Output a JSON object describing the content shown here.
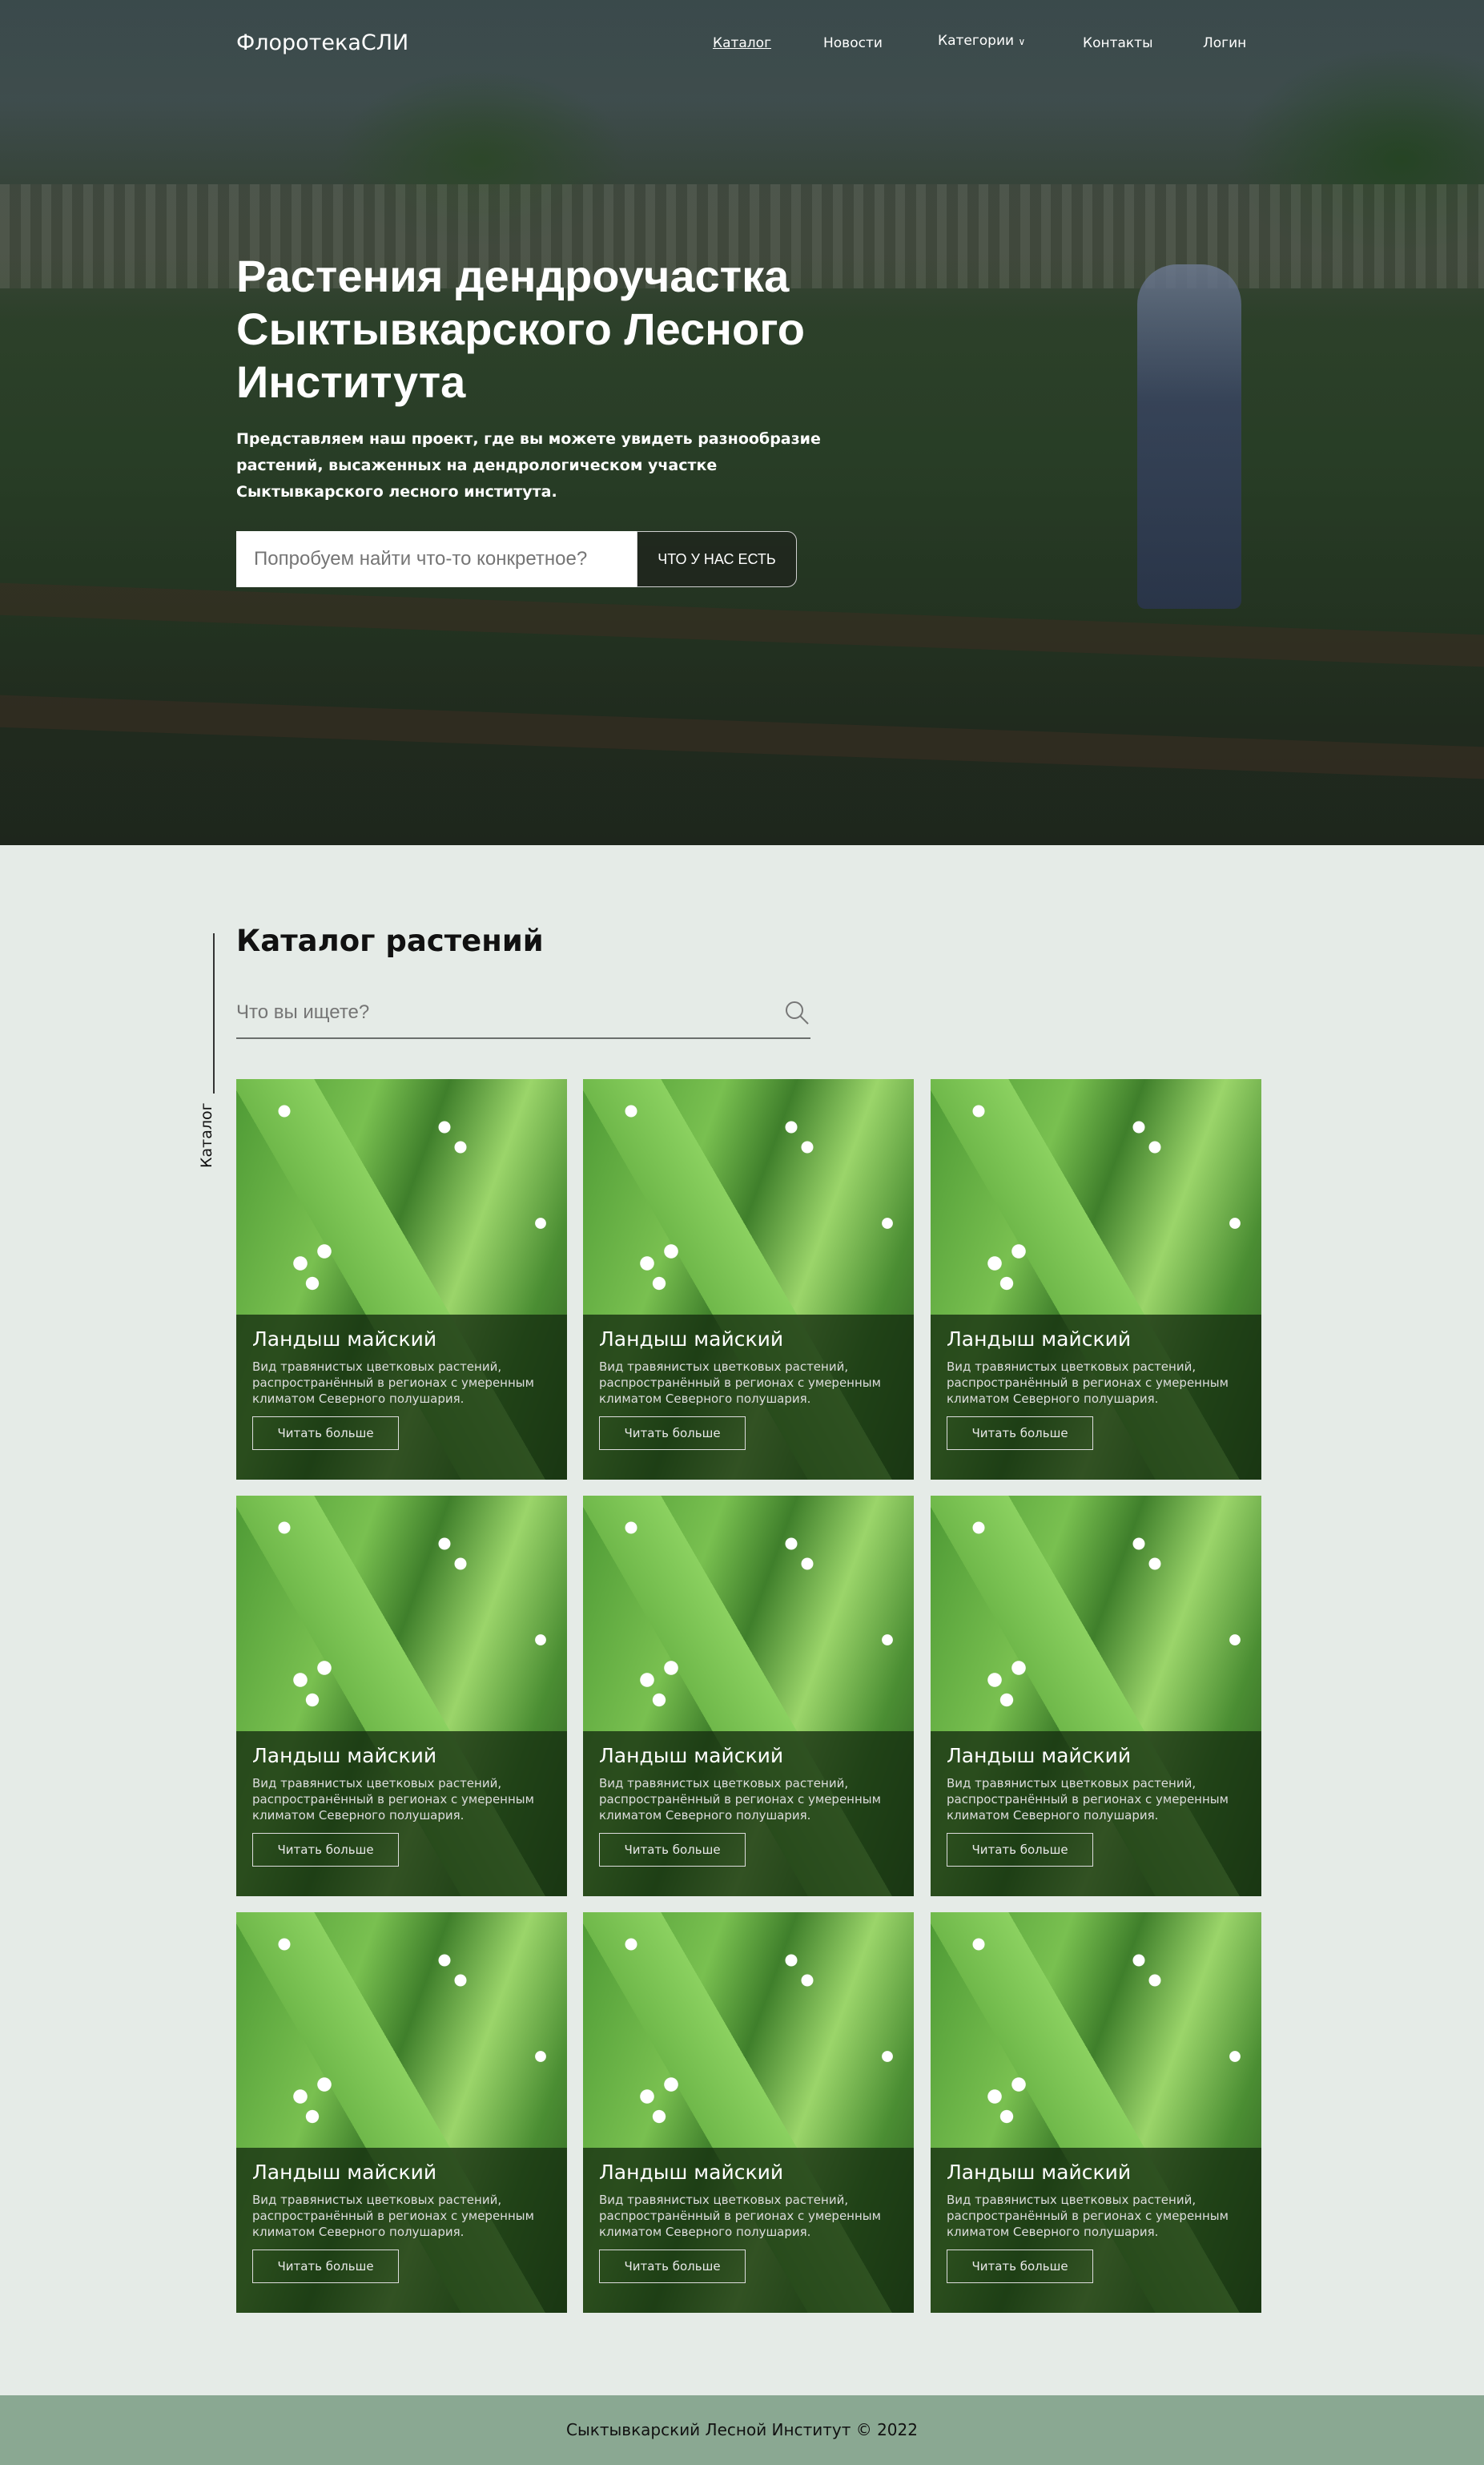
{
  "nav": {
    "logo": "ФлоротекаСЛИ",
    "items": [
      {
        "label": "Каталог"
      },
      {
        "label": "Новости"
      },
      {
        "label": "Категории"
      },
      {
        "label": "Контакты"
      },
      {
        "label": "Логин"
      }
    ]
  },
  "hero": {
    "title": "Растения дендроучастка Сыктывкарского Лесного Института",
    "text": "Представляем наш проект, где вы можете увидеть разнообразие растений, высаженных на дендрологическом участке Сыктывкарского лесного института.",
    "search_placeholder": "Попробуем найти что-то конкретное?",
    "button": "ЧТО У НАС ЕСТЬ"
  },
  "catalog": {
    "side_label": "Каталог",
    "title": "Каталог растений",
    "search_placeholder": "Что вы ищете?",
    "cards": [
      {
        "title": "Ландыш майский",
        "desc": "Вид травянистых цветковых растений, распространённый в регионах с умеренным климатом Северного полушария.",
        "button": "Читать больше"
      },
      {
        "title": "Ландыш майский",
        "desc": "Вид травянистых цветковых растений, распространённый в регионах с умеренным климатом Северного полушария.",
        "button": "Читать больше"
      },
      {
        "title": "Ландыш майский",
        "desc": "Вид травянистых цветковых растений, распространённый в регионах с умеренным климатом Северного полушария.",
        "button": "Читать больше"
      },
      {
        "title": "Ландыш майский",
        "desc": "Вид травянистых цветковых растений, распространённый в регионах с умеренным климатом Северного полушария.",
        "button": "Читать больше"
      },
      {
        "title": "Ландыш майский",
        "desc": "Вид травянистых цветковых растений, распространённый в регионах с умеренным климатом Северного полушария.",
        "button": "Читать больше"
      },
      {
        "title": "Ландыш майский",
        "desc": "Вид травянистых цветковых растений, распространённый в регионах с умеренным климатом Северного полушария.",
        "button": "Читать больше"
      },
      {
        "title": "Ландыш майский",
        "desc": "Вид травянистых цветковых растений, распространённый в регионах с умеренным климатом Северного полушария.",
        "button": "Читать больше"
      },
      {
        "title": "Ландыш майский",
        "desc": "Вид травянистых цветковых растений, распространённый в регионах с умеренным климатом Северного полушария.",
        "button": "Читать больше"
      },
      {
        "title": "Ландыш майский",
        "desc": "Вид травянистых цветковых растений, распространённый в регионах с умеренным климатом Северного полушария.",
        "button": "Читать больше"
      }
    ]
  },
  "footer": {
    "text": "Сыктывкарский Лесной Институт © 2022"
  },
  "colors": {
    "section_bg": "#e5ebe7",
    "footer_bg": "#8aa892"
  }
}
